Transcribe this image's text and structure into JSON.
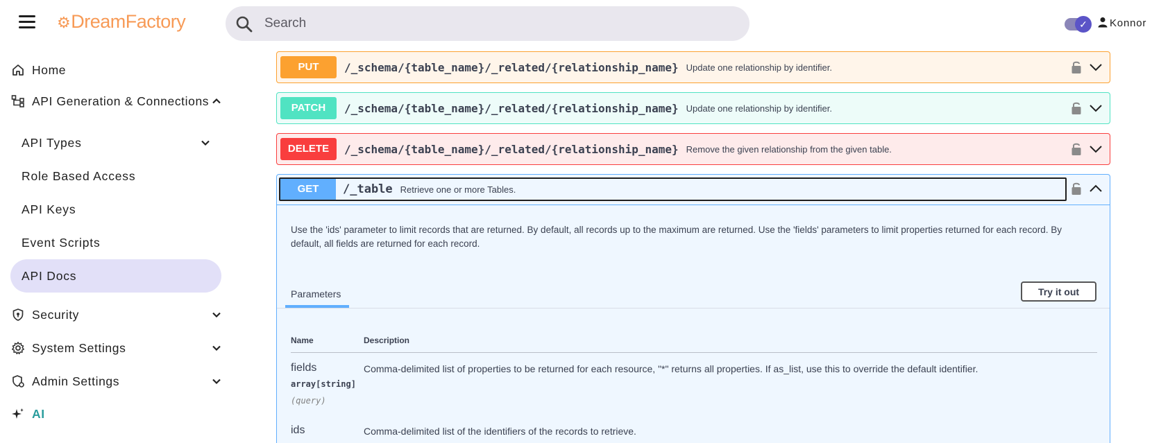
{
  "header": {
    "logo_text": "DreamFactory",
    "search_placeholder": "Search",
    "user_name": "Konnor",
    "brand_color": "#f79a56"
  },
  "sidebar": {
    "home": "Home",
    "api_gen": "API Generation & Connections",
    "sub_items": {
      "api_types": "API Types",
      "role_based_access": "Role Based Access",
      "api_keys": "API Keys",
      "event_scripts": "Event Scripts",
      "api_docs": "API Docs"
    },
    "security": "Security",
    "system_settings": "System Settings",
    "admin_settings": "Admin Settings",
    "ai": "AI",
    "active_color": "#e2e0f8"
  },
  "operations": [
    {
      "method": "PUT",
      "path": "/_schema/{table_name}/_related/{relationship_name}",
      "summary": "Update one relationship by identifier.",
      "color": "#fca130"
    },
    {
      "method": "PATCH",
      "path": "/_schema/{table_name}/_related/{relationship_name}",
      "summary": "Update one relationship by identifier.",
      "color": "#50e3c2"
    },
    {
      "method": "DELETE",
      "path": "/_schema/{table_name}/_related/{relationship_name}",
      "summary": "Remove the given relationship from the given table.",
      "color": "#f93e3e"
    }
  ],
  "get_op": {
    "method": "GET",
    "path": "/_table",
    "summary": "Retrieve one or more Tables.",
    "color": "#61affe",
    "description": "Use the 'ids' parameter to limit records that are returned. By default, all records up to the maximum are returned. Use the 'fields' parameters to limit properties returned for each record. By default, all fields are returned for each record.",
    "tab_label": "Parameters",
    "try_label": "Try it out",
    "col_name": "Name",
    "col_description": "Description",
    "params": [
      {
        "name": "fields",
        "type": "array[string]",
        "in": "(query)",
        "description": "Comma-delimited list of properties to be returned for each resource, \"*\" returns all properties. If as_list, use this to override the default identifier."
      },
      {
        "name": "ids",
        "description": "Comma-delimited list of the identifiers of the records to retrieve."
      }
    ]
  }
}
